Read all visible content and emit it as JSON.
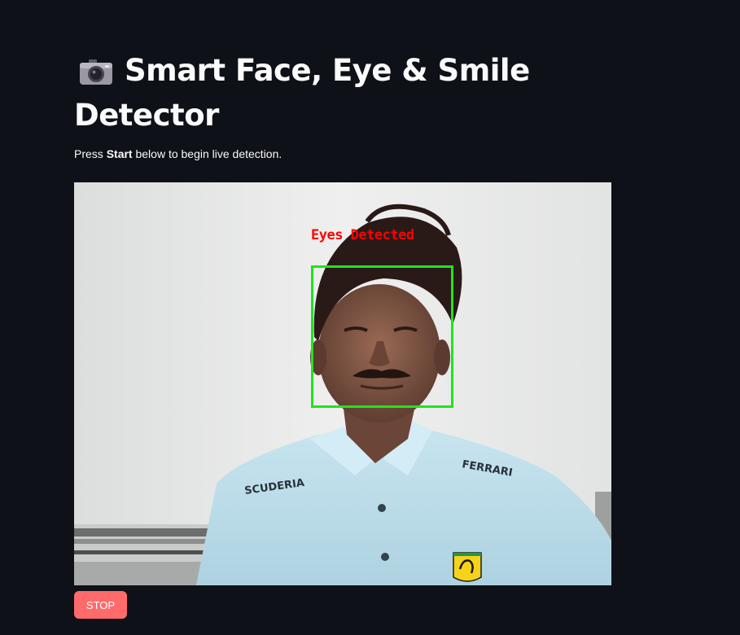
{
  "header": {
    "title": "Smart Face, Eye & Smile Detector",
    "icon": "camera-icon"
  },
  "intro": {
    "prefix": "Press",
    "emphasis": "Start",
    "suffix": "below to begin live detection."
  },
  "video": {
    "overlay_label": "Eyes Detected",
    "overlay_color": "#ff0000",
    "face_box_color": "#1ee51e",
    "shirt_text_left": "SCUDERIA",
    "shirt_text_right": "FERRARI"
  },
  "controls": {
    "stop_label": "STOP",
    "stop_color": "#ff6b6b"
  }
}
